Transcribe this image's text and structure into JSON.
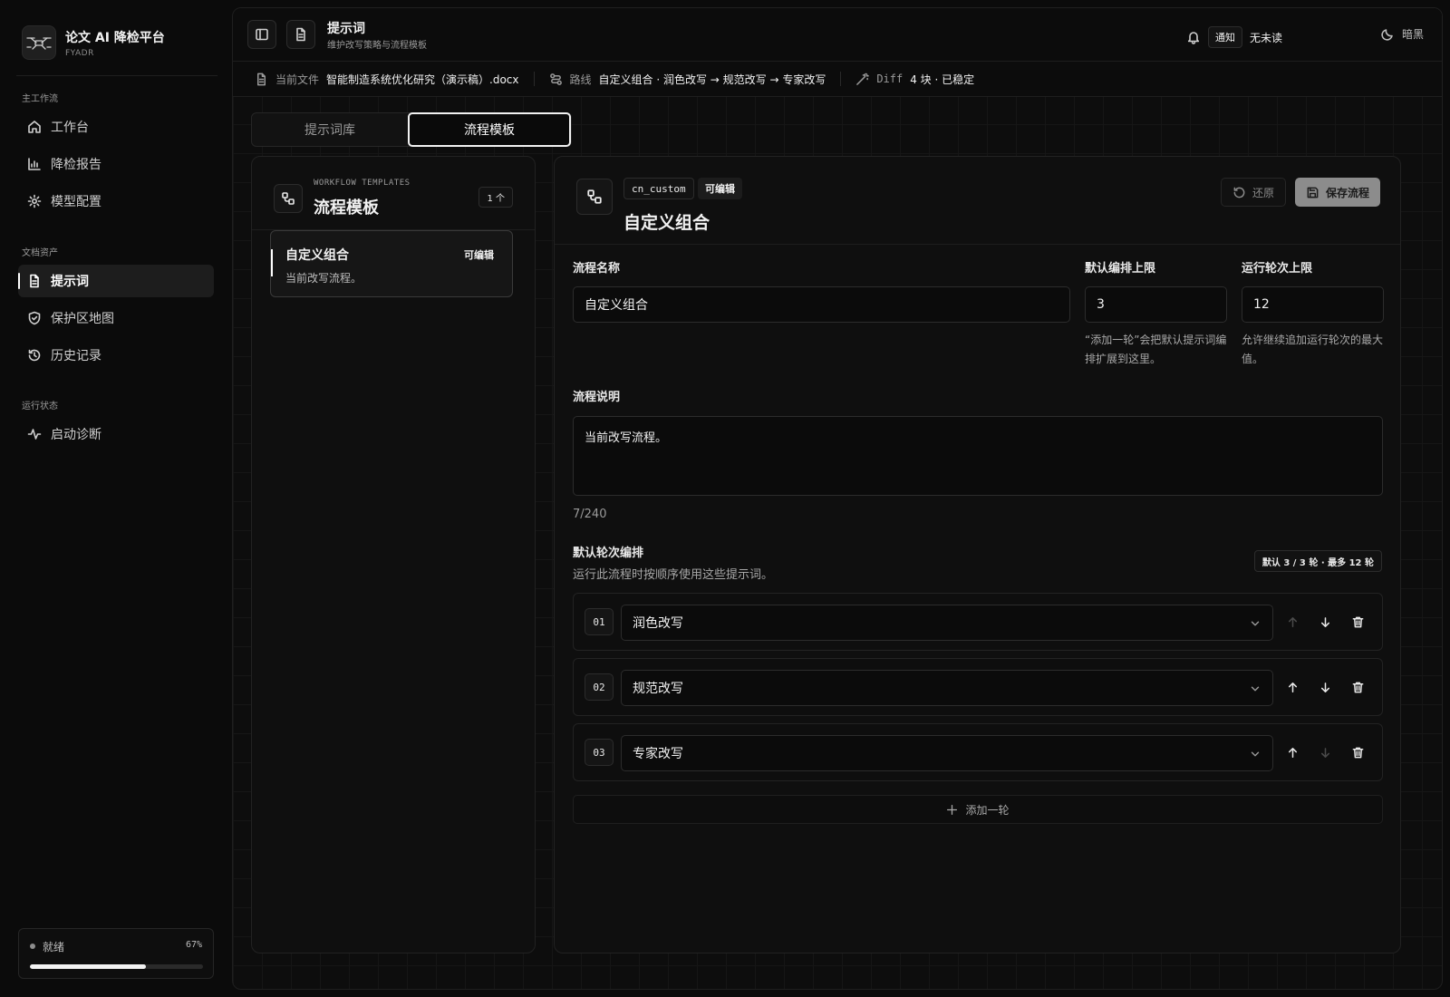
{
  "brand": {
    "title": "论文 AI 降检平台",
    "subtitle": "FYADR",
    "logo_icon": "drone-logo-icon"
  },
  "sidebar": {
    "groups": [
      {
        "label": "主工作流",
        "items": [
          {
            "label": "工作台",
            "icon": "home-icon"
          },
          {
            "label": "降检报告",
            "icon": "bar-chart-icon"
          },
          {
            "label": "模型配置",
            "icon": "gear-icon"
          }
        ]
      },
      {
        "label": "文档资产",
        "items": [
          {
            "label": "提示词",
            "icon": "document-icon",
            "active": true
          },
          {
            "label": "保护区地图",
            "icon": "shield-icon"
          },
          {
            "label": "历史记录",
            "icon": "history-icon"
          }
        ]
      },
      {
        "label": "运行状态",
        "items": [
          {
            "label": "启动诊断",
            "icon": "activity-icon"
          }
        ]
      }
    ],
    "status": {
      "label": "就绪",
      "percent_text": "67%",
      "progress": 0.67
    }
  },
  "header": {
    "title": "提示词",
    "subtitle": "维护改写策略与流程模板",
    "notification_pill": "通知",
    "notification_text": "无未读",
    "theme_label": "暗黑"
  },
  "context": {
    "file_label": "当前文件",
    "file_value": "智能制造系统优化研究（演示稿）.docx",
    "route_label": "路线",
    "route_value": "自定义组合 · 润色改写 → 规范改写 → 专家改写",
    "diff_label": "Diff",
    "diff_value": "4 块 · 已稳定"
  },
  "tabs": [
    {
      "label": "提示词库",
      "active": false
    },
    {
      "label": "流程模板",
      "active": true
    }
  ],
  "templates_panel": {
    "eyebrow": "WORKFLOW TEMPLATES",
    "title": "流程模板",
    "count": "1 个",
    "items": [
      {
        "name": "自定义组合",
        "desc": "当前改写流程。",
        "badge": "可编辑"
      }
    ]
  },
  "editor": {
    "chip_id": "cn_custom",
    "chip_status": "可编辑",
    "title": "自定义组合",
    "restore_label": "还原",
    "save_label": "保存流程",
    "name_label": "流程名称",
    "name_value": "自定义组合",
    "default_limit_label": "默认编排上限",
    "default_limit_value": "3",
    "default_limit_help": "“添加一轮”会把默认提示词编排扩展到这里。",
    "run_limit_label": "运行轮次上限",
    "run_limit_value": "12",
    "run_limit_help": "允许继续追加运行轮次的最大值。",
    "desc_label": "流程说明",
    "desc_value": "当前改写流程。",
    "desc_counter": "7/240",
    "rounds_title": "默认轮次编排",
    "rounds_sub": "运行此流程时按顺序使用这些提示词。",
    "rounds_pill": "默认 3 / 3 轮 · 最多 12 轮",
    "rounds": [
      {
        "num": "01",
        "prompt": "润色改写"
      },
      {
        "num": "02",
        "prompt": "规范改写"
      },
      {
        "num": "03",
        "prompt": "专家改写"
      }
    ],
    "add_round_label": "添加一轮"
  }
}
